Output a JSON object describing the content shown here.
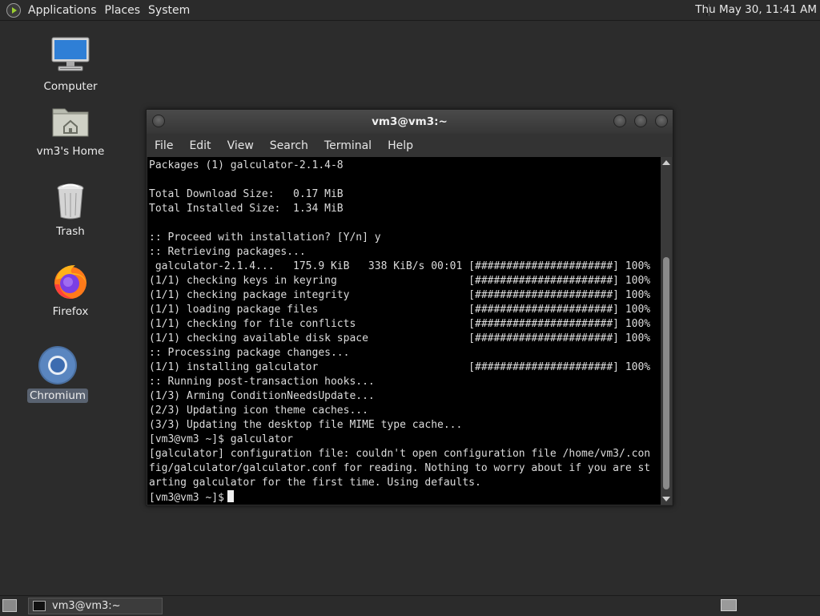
{
  "top_panel": {
    "menus": [
      "Applications",
      "Places",
      "System"
    ],
    "clock": "Thu May 30, 11:41 AM"
  },
  "desktop_icons": [
    {
      "label": "Computer",
      "icon": "computer-icon"
    },
    {
      "label": "vm3's Home",
      "icon": "home-folder-icon"
    },
    {
      "label": "Trash",
      "icon": "trash-icon"
    },
    {
      "label": "Firefox",
      "icon": "firefox-icon"
    },
    {
      "label": "Chromium",
      "icon": "chromium-icon",
      "selected": true
    }
  ],
  "terminal": {
    "title": "vm3@vm3:~",
    "menus": [
      "File",
      "Edit",
      "View",
      "Search",
      "Terminal",
      "Help"
    ],
    "lines": [
      "Packages (1) galculator-2.1.4-8",
      "",
      "Total Download Size:   0.17 MiB",
      "Total Installed Size:  1.34 MiB",
      "",
      ":: Proceed with installation? [Y/n] y",
      ":: Retrieving packages...",
      " galculator-2.1.4...   175.9 KiB   338 KiB/s 00:01 [######################] 100%",
      "(1/1) checking keys in keyring                     [######################] 100%",
      "(1/1) checking package integrity                   [######################] 100%",
      "(1/1) loading package files                        [######################] 100%",
      "(1/1) checking for file conflicts                  [######################] 100%",
      "(1/1) checking available disk space                [######################] 100%",
      ":: Processing package changes...",
      "(1/1) installing galculator                        [######################] 100%",
      ":: Running post-transaction hooks...",
      "(1/3) Arming ConditionNeedsUpdate...",
      "(2/3) Updating icon theme caches...",
      "(3/3) Updating the desktop file MIME type cache...",
      "[vm3@vm3 ~]$ galculator",
      "[galculator] configuration file: couldn't open configuration file /home/vm3/.con",
      "fig/galculator/galculator.conf for reading. Nothing to worry about if you are st",
      "arting galculator for the first time. Using defaults."
    ],
    "prompt": "[vm3@vm3 ~]$"
  },
  "taskbar": {
    "task_label": "vm3@vm3:~"
  },
  "colors": {
    "desktop_bg": "#2c2c2c",
    "panel_bg": "#2b2b2b",
    "terminal_bg": "#000000",
    "terminal_fg": "#dcdcdc",
    "selection_bg": "#596270"
  }
}
